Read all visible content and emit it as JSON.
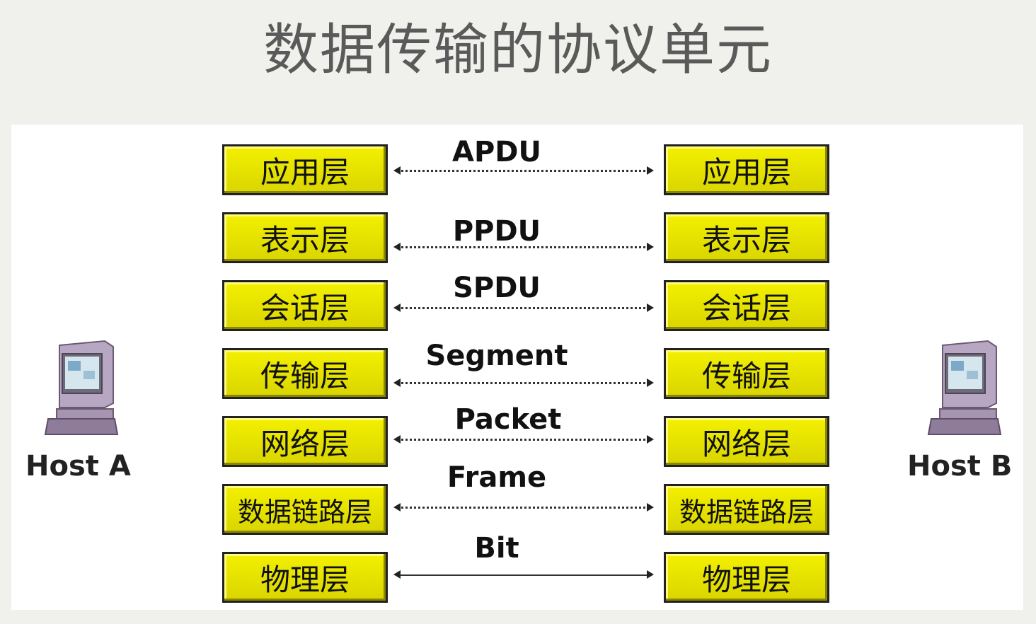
{
  "title": "数据传输的协议单元",
  "hosts": {
    "a": "Host A",
    "b": "Host B"
  },
  "layers": [
    {
      "left": "应用层",
      "right": "应用层",
      "pdu": "APDU",
      "solid": false
    },
    {
      "left": "表示层",
      "right": "表示层",
      "pdu": "PPDU",
      "solid": false
    },
    {
      "left": "会话层",
      "right": "会话层",
      "pdu": "SPDU",
      "solid": false
    },
    {
      "left": "传输层",
      "right": "传输层",
      "pdu": "Segment",
      "solid": false
    },
    {
      "left": "网络层",
      "right": "网络层",
      "pdu": "Packet",
      "solid": false
    },
    {
      "left": "数据链路层",
      "right": "数据链路层",
      "pdu": "Frame",
      "solid": false
    },
    {
      "left": "物理层",
      "right": "物理层",
      "pdu": "Bit",
      "solid": true
    }
  ],
  "colors": {
    "layer_fill": "#e6e200",
    "border": "#222222",
    "computer": "#9a86a6"
  }
}
